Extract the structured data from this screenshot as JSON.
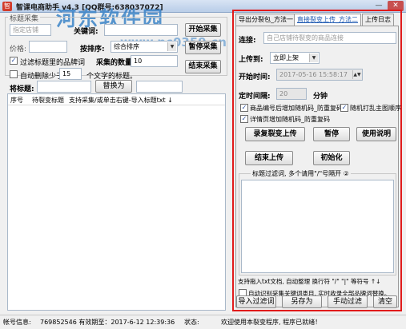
{
  "window": {
    "title": "智课电商助手  v4.3  [QQ群号:638037072]",
    "minimize": "—",
    "close": "✕",
    "icon": "app-icon"
  },
  "watermark": {
    "text": "河东软件园",
    "url": "www.pc0359.cn"
  },
  "left": {
    "section_label": "标题采集",
    "keyword_label": "关键词:",
    "keyword_value": "",
    "link_placeholder": "指定店铺",
    "price_label": "价格:",
    "price_value": "",
    "sort_label": "按排序:",
    "sort_value": "综合排序",
    "count_label": "采集的数量:",
    "count_value": "10",
    "filter_label": "过滤标题里的品牌词",
    "autodelete_label": "自动删除少于:",
    "autodelete_value": "15",
    "autodelete_suffix": "个文字的标题。",
    "replace_label": "将标题:",
    "replace_from": "",
    "replace_button": "替换为",
    "replace_to": "",
    "start_button": "开始采集",
    "pause_button": "暂停采集",
    "stop_button": "结束采集",
    "columns": [
      "序号",
      "待裂变标题",
      "支持采集/或单击右键-导入标题txt ↓"
    ]
  },
  "right": {
    "tabs": [
      "导出分裂包_方法一",
      "直接裂变上传_方法二",
      "上传日志"
    ],
    "active_tab": 1,
    "link_label": "连接:",
    "link_placeholder": "自己店铺待裂变的商品连接",
    "upload_label": "上传到:",
    "upload_value": "立即上架",
    "start_time_label": "开始时间:",
    "start_time_value": "2017-05-16 15:58:17",
    "interval_label": "定时间隔:",
    "interval_value": "20",
    "interval_unit": "分钟",
    "options": [
      {
        "label": "商品编号后增加随机码_防重复码",
        "checked": true
      },
      {
        "label": "随机打乱主图顺序",
        "checked": true
      },
      {
        "label": "详情页增加随机码_防重复码",
        "checked": true
      }
    ],
    "buttons": {
      "start_upload": "录复裂变上传",
      "pause": "暂停",
      "help": "使用说明",
      "stop_upload": "结束上传",
      "init": "初始化"
    },
    "filter_hint": "标题过滤词, 多个请用\"/\"号隔开 ②",
    "filter_words": "",
    "txt_hint": "支持拖入txt文档, 自动整理 换行符 \"/\" \"|\" 等符号 ↑↓",
    "auto_brand_label": "自动识别采集关键词类目, 实时收录全部品牌词替换。",
    "import_button": "导入过滤词",
    "save_button": "另存为",
    "manual_filter_button": "手动过滤",
    "clear_button": "清空"
  },
  "status": {
    "account_label": "帐号信息:",
    "account_value": "769852546  有效期至：2017-6-12 12:39:36",
    "state_label": "状态:",
    "state_value": "欢迎使用本裂变程序, 程序已就绪！"
  }
}
